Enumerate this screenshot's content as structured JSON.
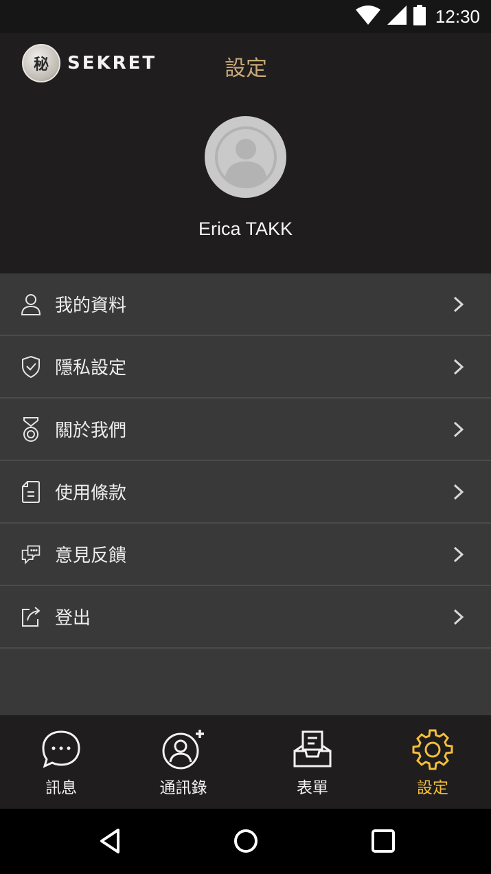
{
  "status_bar": {
    "time": "12:30",
    "icons": [
      "wifi-icon",
      "cell-signal-icon",
      "battery-icon"
    ]
  },
  "header": {
    "logo_text": "SEKRET",
    "logo_glyph": "秘",
    "title": "設定",
    "title_color": "#c8a878"
  },
  "profile": {
    "avatar_icon": "person-avatar-icon",
    "name": "Erica TAKK"
  },
  "menu": {
    "items": [
      {
        "label": "我的資料",
        "icon": "user-icon"
      },
      {
        "label": "隱私設定",
        "icon": "shield-check-icon"
      },
      {
        "label": "關於我們",
        "icon": "medal-icon"
      },
      {
        "label": "使用條款",
        "icon": "document-icon"
      },
      {
        "label": "意見反饋",
        "icon": "chat-bubbles-icon"
      },
      {
        "label": "登出",
        "icon": "logout-share-icon"
      }
    ]
  },
  "bottom_nav": {
    "active_color": "#f3bf3a",
    "tabs": [
      {
        "label": "訊息",
        "icon": "chat-bubble-icon",
        "active": false
      },
      {
        "label": "通訊錄",
        "icon": "add-contact-icon",
        "active": false
      },
      {
        "label": "表單",
        "icon": "inbox-form-icon",
        "active": false
      },
      {
        "label": "設定",
        "icon": "gear-icon",
        "active": true
      }
    ]
  },
  "system_nav": {
    "buttons": [
      "back-icon",
      "home-icon",
      "recents-icon"
    ]
  }
}
